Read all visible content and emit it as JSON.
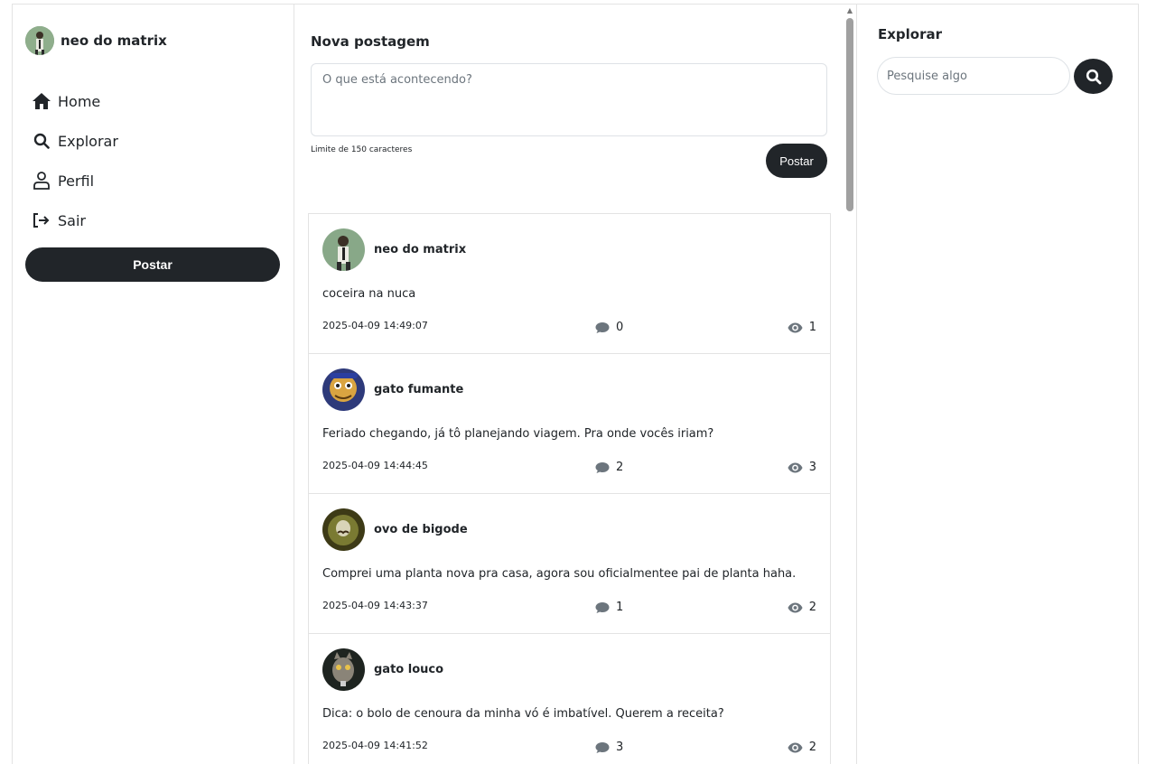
{
  "sidebar": {
    "user_name": "neo do matrix",
    "nav": [
      {
        "label": "Home",
        "icon": "home-icon"
      },
      {
        "label": "Explorar",
        "icon": "search-icon"
      },
      {
        "label": "Perfil",
        "icon": "user-icon"
      },
      {
        "label": "Sair",
        "icon": "logout-icon"
      }
    ],
    "post_button": "Postar"
  },
  "composer": {
    "title": "Nova postagem",
    "placeholder": "O que está acontecendo?",
    "limit_text": "Limite de 150 caracteres",
    "post_button": "Postar"
  },
  "feed": [
    {
      "author": "neo do matrix",
      "text": "coceira na nuca",
      "date": "2025-04-09 14:49:07",
      "comments": "0",
      "views": "1"
    },
    {
      "author": "gato fumante",
      "text": "Feriado chegando, já tô planejando viagem. Pra onde vocês iriam?",
      "date": "2025-04-09 14:44:45",
      "comments": "2",
      "views": "3"
    },
    {
      "author": "ovo de bigode",
      "text": "Comprei uma planta nova pra casa, agora sou oficialmentee pai de planta haha.",
      "date": "2025-04-09 14:43:37",
      "comments": "1",
      "views": "2"
    },
    {
      "author": "gato louco",
      "text": "Dica: o bolo de cenoura da minha vó é imbatível. Querem a receita?",
      "date": "2025-04-09 14:41:52",
      "comments": "3",
      "views": "2"
    }
  ],
  "explore": {
    "title": "Explorar",
    "search_placeholder": "Pesquise algo"
  },
  "colors": {
    "primary_dark": "#212529",
    "border": "#e3e3e3",
    "muted_icon": "#6c757d"
  }
}
